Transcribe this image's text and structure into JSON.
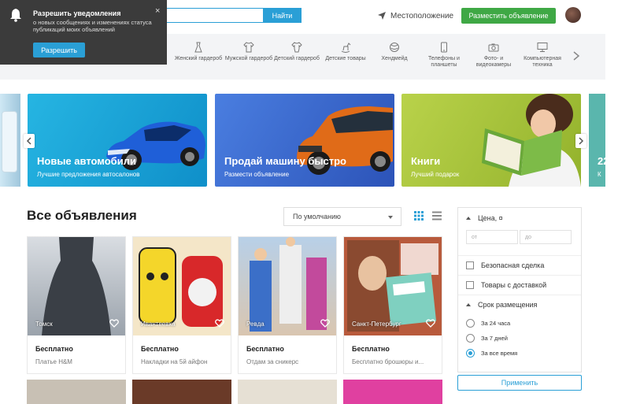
{
  "header": {
    "search_button": "Найти",
    "location": "Местоположение",
    "post_button": "Разместить объявление"
  },
  "categories": [
    {
      "label": "Женский гардероб",
      "icon": "dress-icon"
    },
    {
      "label": "Мужской гардероб",
      "icon": "tshirt-icon"
    },
    {
      "label": "Детский гардероб",
      "icon": "baby-clothes-icon"
    },
    {
      "label": "Детские товары",
      "icon": "rocking-horse-icon"
    },
    {
      "label": "Хендмейд",
      "icon": "yarn-icon"
    },
    {
      "label": "Телефоны и планшеты",
      "icon": "phone-icon"
    },
    {
      "label": "Фото- и видеокамеры",
      "icon": "camera-icon"
    },
    {
      "label": "Компьютерная техника",
      "icon": "monitor-icon"
    }
  ],
  "notification": {
    "title": "Разрешить уведомления",
    "text": "о новых сообщениях и изменениях статуса публикаций моих объявлений",
    "allow_button": "Разрешить",
    "close": "×"
  },
  "banners": [
    {
      "title": "Новые автомобили",
      "subtitle": "Лучшие предложения автосалонов",
      "color": "#1aa7d8"
    },
    {
      "title": "Продай машину быстро",
      "subtitle": "Размести объявление",
      "color": "#3c6fcf"
    },
    {
      "title": "Книги",
      "subtitle": "Лучший подарок",
      "color": "#a8c63c"
    }
  ],
  "banner_edge": {
    "title": "22",
    "subtitle": "К"
  },
  "listings": {
    "title": "Все объявления",
    "sort": "По умолчанию",
    "items": [
      {
        "city": "Томск",
        "price": "Бесплатно",
        "title": "Платье H&M"
      },
      {
        "city": "Ивантеевка",
        "price": "Бесплатно",
        "title": "Накладки на 5й айфон"
      },
      {
        "city": "Ревда",
        "price": "Бесплатно",
        "title": "Отдам за сникерс"
      },
      {
        "city": "Санкт-Петербург",
        "price": "Бесплатно",
        "title": "Бесплатно брошюры и..."
      }
    ]
  },
  "filters": {
    "price_label": "Цена, ¤",
    "price_from": "от",
    "price_to": "до",
    "safe_deal": "Безопасная сделка",
    "delivery": "Товары с доставкой",
    "period_label": "Срок размещения",
    "periods": [
      {
        "label": "За 24 часа",
        "selected": false
      },
      {
        "label": "За 7 дней",
        "selected": false
      },
      {
        "label": "За все время",
        "selected": true
      }
    ],
    "apply_button": "Применить"
  },
  "colors": {
    "accent": "#2a9fd6",
    "green": "#3fa845"
  }
}
